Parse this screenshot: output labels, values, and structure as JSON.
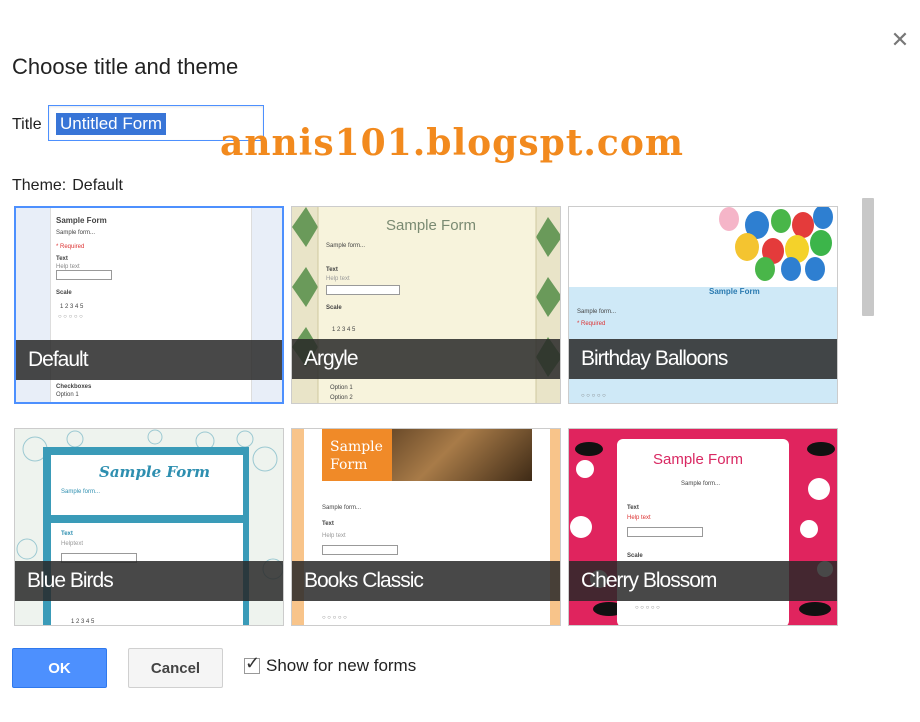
{
  "dialog": {
    "title": "Choose title and theme",
    "close_icon": "close-icon"
  },
  "title_field": {
    "label": "Title",
    "value": "Untitled Form"
  },
  "watermark": "annis101.blogspt.com",
  "theme": {
    "label": "Theme:",
    "current": "Default"
  },
  "themes": [
    {
      "name": "Default",
      "selected": true
    },
    {
      "name": "Argyle",
      "selected": false
    },
    {
      "name": "Birthday Balloons",
      "selected": false
    },
    {
      "name": "Blue Birds",
      "selected": false
    },
    {
      "name": "Books Classic",
      "selected": false
    },
    {
      "name": "Cherry Blossom",
      "selected": false
    }
  ],
  "previews": {
    "sample_form": "Sample Form",
    "sample_form_split": [
      "Sample",
      "Form"
    ],
    "sample_form_desc": "Sample form...",
    "text_label": "Text",
    "help_text": "Help text",
    "scale_label": "Scale",
    "required": "* Required",
    "checkboxes": "Checkboxes",
    "option1": "Option 1",
    "option2": "Option 2",
    "scale_nums": "1  2  3  4  5",
    "scale_circles": "○ ○ ○ ○ ○",
    "help_text_alt": "Helptext"
  },
  "footer": {
    "ok_label": "OK",
    "cancel_label": "Cancel",
    "show_new_forms_label": "Show for new forms",
    "show_new_forms_checked": true
  },
  "colors": {
    "accent": "#4d90fe",
    "watermark": "#f28a1e",
    "selected_border": "#4d90fe"
  }
}
